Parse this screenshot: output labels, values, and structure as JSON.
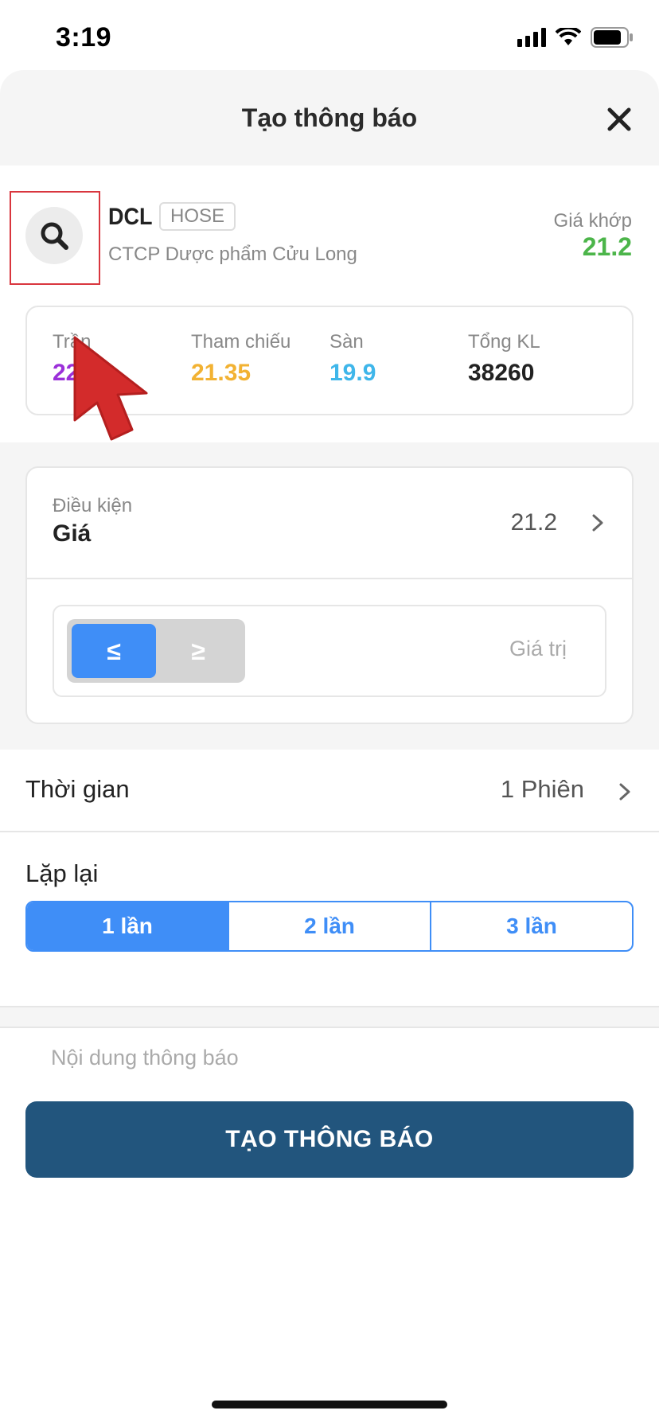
{
  "status_bar": {
    "time": "3:19"
  },
  "header": {
    "title": "Tạo thông báo"
  },
  "stock": {
    "ticker": "DCL",
    "exchange": "HOSE",
    "company": "CTCP Dược phẩm Cửu Long",
    "match_label": "Giá khớp",
    "match_price": "21.2"
  },
  "stats": [
    {
      "label": "Trần",
      "value": "22.8",
      "color": "#9b30d9"
    },
    {
      "label": "Tham chiếu",
      "value": "21.35",
      "color": "#f2b233"
    },
    {
      "label": "Sàn",
      "value": "19.9",
      "color": "#3fb6ea"
    },
    {
      "label": "Tổng KL",
      "value": "38260",
      "color": "#222222"
    }
  ],
  "condition": {
    "label": "Điều kiện",
    "value": "Giá",
    "price": "21.2",
    "ops": [
      "≤",
      "≥"
    ],
    "selected_op": "≤",
    "value_placeholder": "Giá trị"
  },
  "time": {
    "label": "Thời gian",
    "value": "1 Phiên"
  },
  "repeat": {
    "label": "Lặp lại",
    "options": [
      "1 lần",
      "2 lần",
      "3 lần"
    ],
    "selected": "1 lần"
  },
  "content_placeholder": "Nội dung thông báo",
  "create_button": "TẠO THÔNG BÁO",
  "colors": {
    "accent": "#3f8ef7",
    "primary_button": "#22557d",
    "match_price": "#4cb54a"
  }
}
